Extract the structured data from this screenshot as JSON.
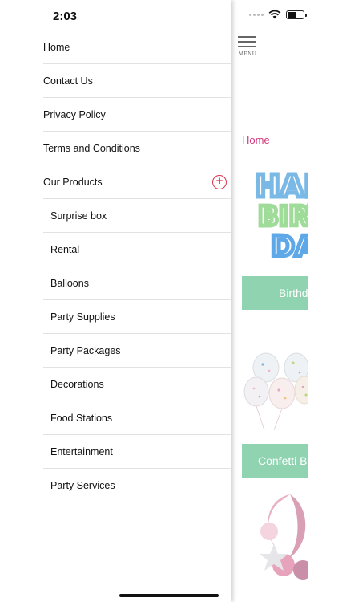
{
  "status": {
    "time": "2:03"
  },
  "drawer": {
    "items": [
      {
        "label": "Home"
      },
      {
        "label": "Contact Us"
      },
      {
        "label": "Privacy Policy"
      },
      {
        "label": "Terms and Conditions"
      },
      {
        "label": "Our Products"
      },
      {
        "label": "Surprise box"
      },
      {
        "label": "Rental"
      },
      {
        "label": "Balloons"
      },
      {
        "label": "Party Supplies"
      },
      {
        "label": "Party Packages"
      },
      {
        "label": "Decorations"
      },
      {
        "label": "Food Stations"
      },
      {
        "label": "Entertainment"
      },
      {
        "label": "Party Services"
      }
    ],
    "expand_icon": "plus-circle-icon",
    "expand_color": "#d8344d"
  },
  "page": {
    "menu_label": "MENU",
    "breadcrumb": "Home",
    "accent_color": "#d3357a",
    "button_color": "#8fd3b0",
    "categories": [
      {
        "label": "Birthday"
      },
      {
        "label": "Confetti Balloons"
      }
    ],
    "image_text": "HAPPY BIRTHDAY"
  }
}
